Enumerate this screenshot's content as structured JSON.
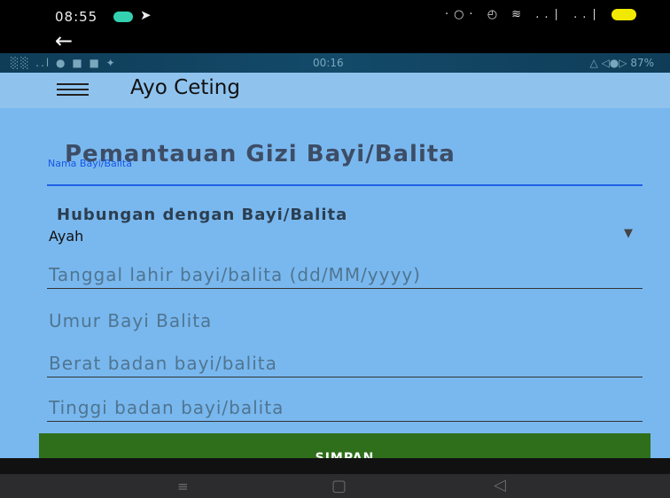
{
  "outer_status": {
    "time": "08:55",
    "right_icons": "·○· ◴ ≋ ..∣ ..∣"
  },
  "inner_status": {
    "left_icons": "░░ ..l ● ■ ■ ✦",
    "time": "00:16",
    "right_icons": "△ ◁●▷ 87%"
  },
  "app_bar": {
    "title": "Ayo Ceting"
  },
  "form": {
    "page_title": "Pemantauan Gizi Bayi/Balita",
    "name_label": "Nama Bayi/Balita",
    "relation_label": "Hubungan dengan Bayi/Balita",
    "relation_value": "Ayah",
    "birthdate_placeholder": "Tanggal lahir bayi/balita (dd/MM/yyyy)",
    "age_placeholder": "Umur Bayi Balita",
    "weight_placeholder": "Berat badan bayi/balita",
    "height_placeholder": "Tinggi badan bayi/balita",
    "save_label": "SIMPAN"
  },
  "colors": {
    "app_bar": "#8fc3ee",
    "form_background": "#79b8ef",
    "save_button": "#2f6f1b",
    "accent": "#1f60e6"
  }
}
